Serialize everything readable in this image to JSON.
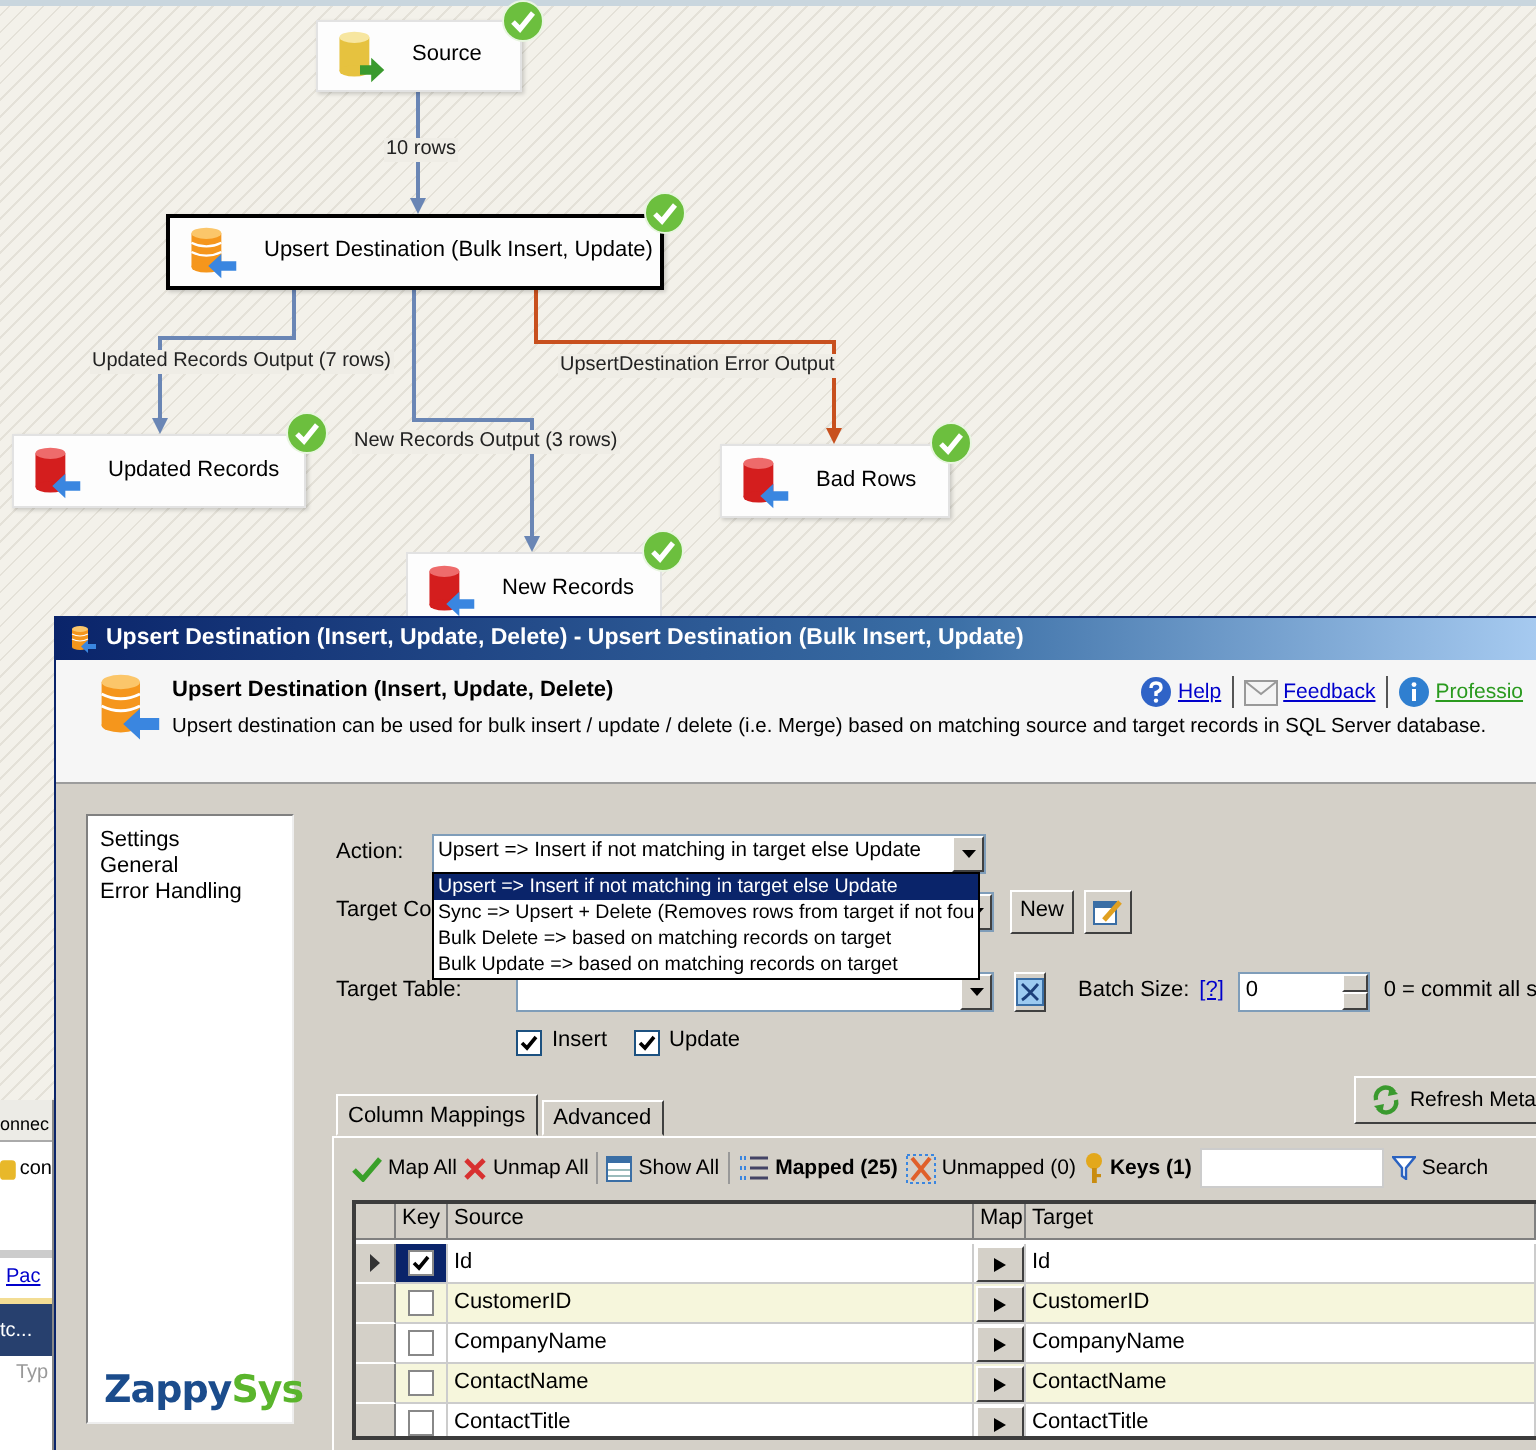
{
  "canvas": {
    "nodes": [
      {
        "label": "Source",
        "kind": "source",
        "selected": false,
        "succeeded": true
      },
      {
        "label": "Upsert Destination (Bulk Insert, Update)",
        "kind": "upsert",
        "selected": true,
        "succeeded": true
      },
      {
        "label": "Updated Records",
        "kind": "destination",
        "selected": false,
        "succeeded": true
      },
      {
        "label": "Bad Rows",
        "kind": "destination",
        "selected": false,
        "succeeded": true
      },
      {
        "label": "New Records",
        "kind": "destination",
        "selected": false,
        "succeeded": true
      }
    ],
    "paths": [
      {
        "label": "10 rows",
        "kind": "data"
      },
      {
        "label": "Updated Records Output (7 rows)",
        "kind": "data"
      },
      {
        "label": "New Records Output (3 rows)",
        "kind": "data"
      },
      {
        "label": "UpsertDestination Error Output",
        "kind": "error"
      }
    ]
  },
  "background_window": {
    "items": [
      {
        "text": "onnec",
        "kind": "header"
      },
      {
        "text": "con",
        "kind": "item"
      },
      {
        "text": "Pac",
        "kind": "link"
      },
      {
        "text": "tc...",
        "kind": "bar"
      },
      {
        "text": "Typ",
        "kind": "column"
      }
    ]
  },
  "dialog": {
    "title": "Upsert Destination (Insert, Update, Delete) - Upsert Destination (Bulk Insert, Update)",
    "heading": "Upsert Destination (Insert, Update, Delete)",
    "description": "Upsert destination can be used for bulk insert / update / delete (i.e. Merge) based on matching source and target records in SQL Server database.",
    "links": [
      {
        "label": "Help",
        "kind": "help"
      },
      {
        "label": "Feedback",
        "kind": "feedback"
      },
      {
        "label": "Professio",
        "kind": "info"
      }
    ],
    "nav_items": [
      "Settings",
      "General",
      "Error Handling"
    ],
    "logo": [
      {
        "text": "Zappy",
        "color": "#1b4c8c"
      },
      {
        "text": "Sys",
        "color": "#5ab52c"
      }
    ],
    "action": {
      "label": "Action:",
      "value": "Upsert => Insert if not matching in target else Update",
      "options": [
        {
          "label": "Upsert => Insert if not matching in target else Update",
          "selected": true
        },
        {
          "label": "Sync => Upsert + Delete (Removes rows from target if not fou",
          "selected": false
        },
        {
          "label": "Bulk Delete => based on matching records on target",
          "selected": false
        },
        {
          "label": "Bulk Update => based on matching records on target",
          "selected": false
        }
      ]
    },
    "target_connection": {
      "label": "Target Co",
      "new_button": "New"
    },
    "target_table": {
      "label": "Target Table:"
    },
    "batch_size": {
      "label": "Batch Size:",
      "help": "[?]",
      "value": "0",
      "note": "0 = commit all s"
    },
    "operations": [
      {
        "label": "Insert",
        "checked": true
      },
      {
        "label": "Update",
        "checked": true
      }
    ],
    "refresh_button": "Refresh Meta",
    "tabs": [
      {
        "label": "Column Mappings",
        "selected": true
      },
      {
        "label": "Advanced",
        "selected": false
      }
    ],
    "toolbar": [
      {
        "label": "Map All",
        "kind": "map",
        "bold": false
      },
      {
        "label": "Unmap All",
        "kind": "unmap",
        "bold": false
      },
      {
        "label": "Show All",
        "kind": "show",
        "bold": false
      },
      {
        "label": "Mapped (25)",
        "kind": "mapped",
        "bold": true
      },
      {
        "label": "Unmapped (0)",
        "kind": "unmapped",
        "bold": false
      },
      {
        "label": "Keys (1)",
        "kind": "keys",
        "bold": true
      }
    ],
    "search_button": "Search",
    "grid": {
      "columns": [
        "Key",
        "Source",
        "Map",
        "Target"
      ],
      "rows": [
        {
          "key": true,
          "source": "Id",
          "target": "Id",
          "current": true
        },
        {
          "key": false,
          "source": "CustomerID",
          "target": "CustomerID",
          "current": false
        },
        {
          "key": false,
          "source": "CompanyName",
          "target": "CompanyName",
          "current": false
        },
        {
          "key": false,
          "source": "ContactName",
          "target": "ContactName",
          "current": false
        },
        {
          "key": false,
          "source": "ContactTitle",
          "target": "ContactTitle",
          "current": false
        }
      ]
    }
  }
}
